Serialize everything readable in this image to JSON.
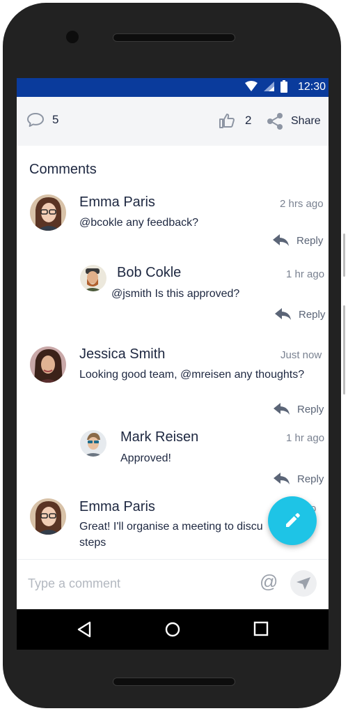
{
  "status_bar": {
    "time": "12:30",
    "background": "#0a3b9c"
  },
  "actions": {
    "comment_count": "5",
    "like_count": "2",
    "share_label": "Share"
  },
  "comments_section": {
    "title": "Comments",
    "items": [
      {
        "author": "Emma Paris",
        "time": "2 hrs ago",
        "text": "@bcokle  any feedback?",
        "reply_label": "Reply",
        "avatar": "emma-avatar"
      },
      {
        "author": "Bob Cokle",
        "time": "1 hr ago",
        "text": "@jsmith  Is this approved?",
        "reply_label": "Reply",
        "avatar": "bob-avatar"
      },
      {
        "author": "Jessica Smith",
        "time": "Just now",
        "text": "Looking good team, @mreisen any thoughts?",
        "reply_label": "Reply",
        "avatar": "jessica-avatar"
      },
      {
        "author": "Mark Reisen",
        "time": "1 hr ago",
        "text": "Approved!",
        "reply_label": "Reply",
        "avatar": "mark-avatar"
      },
      {
        "author": "Emma Paris",
        "time": "o",
        "text_line1": "Great! I'll organise a meeting to discu",
        "text_line2": "steps",
        "avatar": "emma-avatar"
      }
    ]
  },
  "composer": {
    "placeholder": "Type a comment",
    "mention_symbol": "@"
  },
  "colors": {
    "accent": "#1ec4e6",
    "text": "#1d2740",
    "muted": "#7a8291"
  },
  "icons": [
    "comment-icon",
    "thumbs-up-icon",
    "share-icon",
    "reply-icon",
    "send-icon",
    "pencil-icon",
    "back-icon",
    "home-icon",
    "recents-icon",
    "wifi-icon",
    "signal-icon",
    "battery-icon"
  ]
}
